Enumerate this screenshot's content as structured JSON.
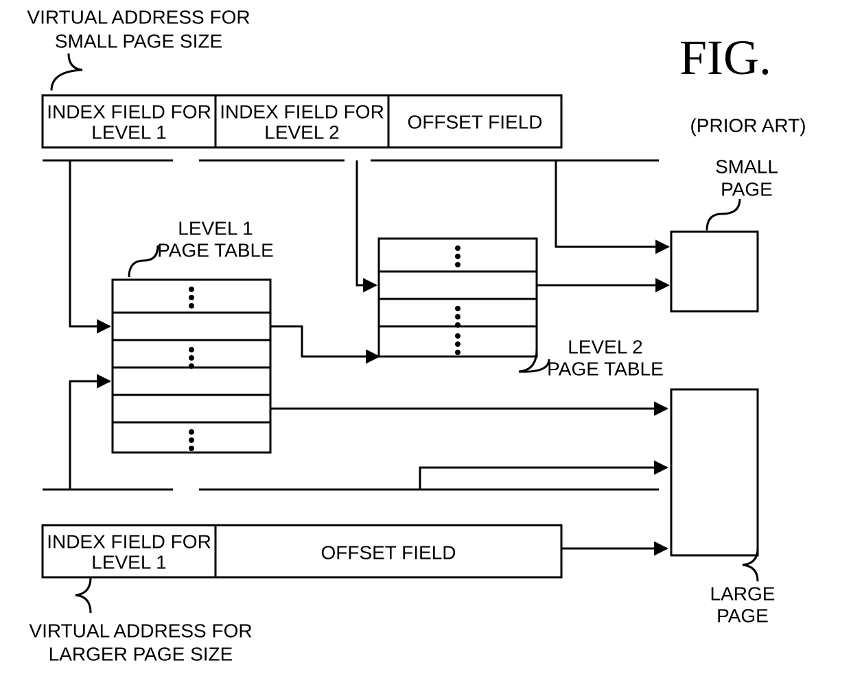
{
  "fig_label": "FIG.",
  "prior_art": "(PRIOR ART)",
  "top_title_1": "VIRTUAL ADDRESS FOR",
  "top_title_2": "SMALL PAGE SIZE",
  "small_addr_field1_1": "INDEX FIELD FOR",
  "small_addr_field1_2": "LEVEL 1",
  "small_addr_field2_1": "INDEX FIELD FOR",
  "small_addr_field2_2": "LEVEL 2",
  "small_addr_field3": "OFFSET FIELD",
  "small_page_1": "SMALL",
  "small_page_2": "PAGE",
  "l1_label_1": "LEVEL 1",
  "l1_label_2": "PAGE TABLE",
  "l2_label_1": "LEVEL 2",
  "l2_label_2": "PAGE TABLE",
  "large_addr_field1_1": "INDEX FIELD FOR",
  "large_addr_field1_2": "LEVEL 1",
  "large_addr_field2": "OFFSET FIELD",
  "large_page_1": "LARGE",
  "large_page_2": "PAGE",
  "bottom_title_1": "VIRTUAL ADDRESS FOR",
  "bottom_title_2": "LARGER PAGE SIZE"
}
